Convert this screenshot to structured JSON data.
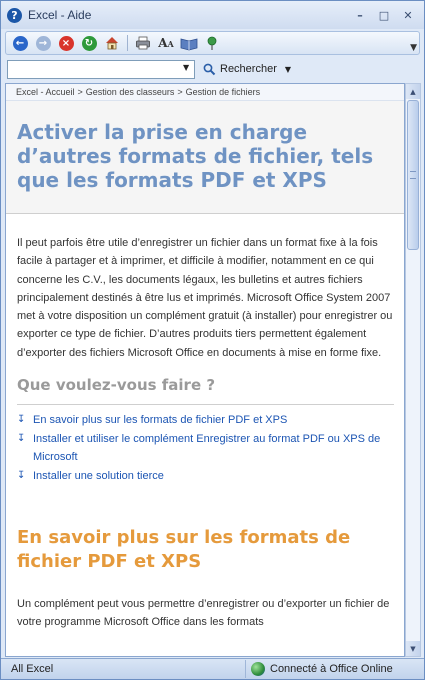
{
  "window": {
    "title": "Excel - Aide"
  },
  "breadcrumb": [
    "Excel - Accueil",
    "Gestion des classeurs",
    "Gestion de fichiers"
  ],
  "search": {
    "value": "",
    "button_label": "Rechercher"
  },
  "article": {
    "title": "Activer la prise en charge d’autres formats de fichier, tels que les formats PDF et XPS",
    "intro": "Il peut parfois être utile d’enregistrer un fichier dans un format fixe à la fois facile à partager et à imprimer, et difficile à modifier, notamment en ce qui concerne les C.V., les documents légaux, les bulletins et autres fichiers principalement destinés à être lus et imprimés. Microsoft Office System 2007 met à votre disposition un complément gratuit (à installer) pour enregistrer ou exporter ce type de fichier. D’autres produits tiers permettent également d’exporter des fichiers Microsoft Office en documents à mise en forme fixe.",
    "what_heading": "Que voulez-vous faire ?",
    "links": [
      "En savoir plus sur les formats de fichier PDF et XPS",
      "Installer et utiliser le complément Enregistrer au format PDF ou XPS de Microsoft",
      "Installer une solution tierce"
    ],
    "section_heading": "En savoir plus sur les formats de fichier PDF et XPS",
    "section_text": "Un complément peut vous permettre d’enregistrer ou d’exporter un fichier de votre programme Microsoft Office dans les formats"
  },
  "status": {
    "left": "All Excel",
    "right": "Connecté à Office Online"
  },
  "colors": {
    "title_blue": "#6f93c3",
    "section_orange": "#e59a3c",
    "link_blue": "#1c55b3"
  }
}
